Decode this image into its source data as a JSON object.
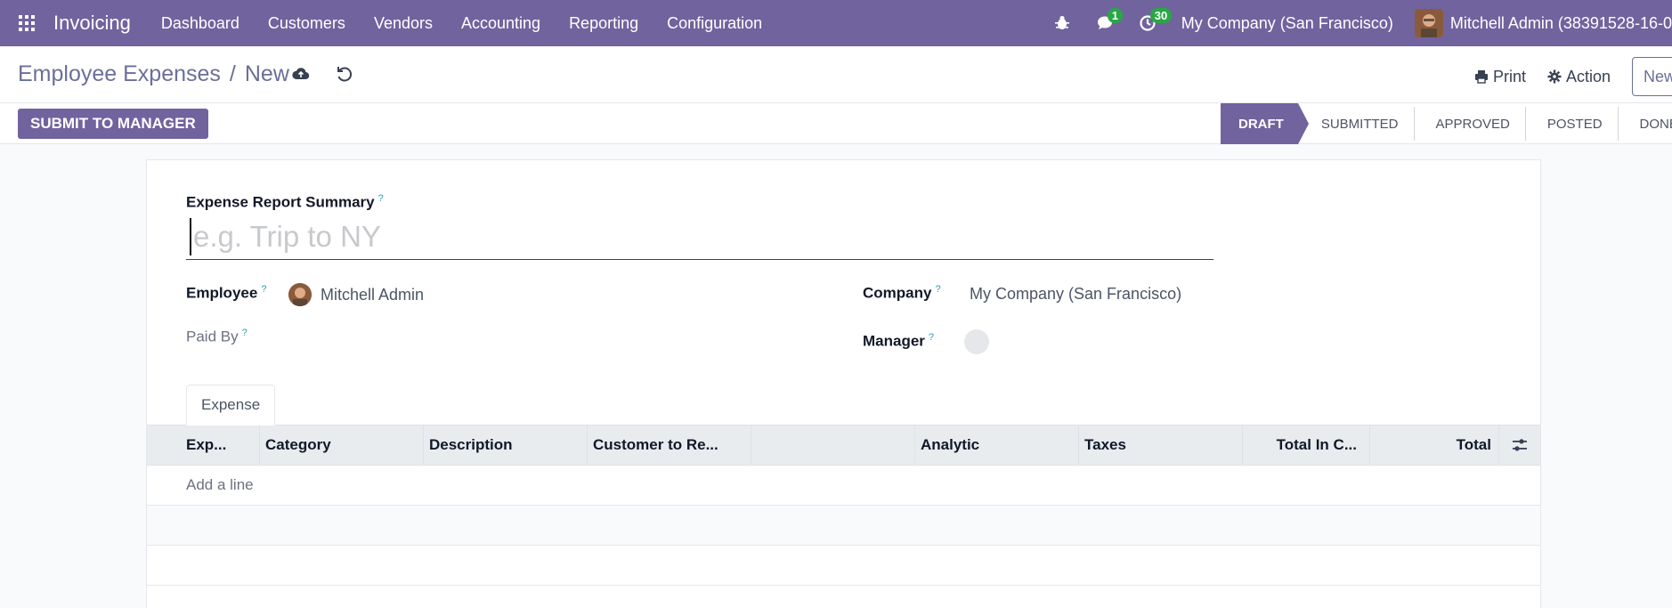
{
  "navbar": {
    "app_name": "Invoicing",
    "menu": [
      "Dashboard",
      "Customers",
      "Vendors",
      "Accounting",
      "Reporting",
      "Configuration"
    ],
    "messages_count": "1",
    "activities_count": "30",
    "company": "My Company (San Francisco)",
    "user": "Mitchell Admin (38391528-16-0"
  },
  "control_panel": {
    "breadcrumb_parent": "Employee Expenses",
    "separator": "/",
    "breadcrumb_current": "New",
    "print_label": "Print",
    "action_label": "Action",
    "new_label": "New"
  },
  "statusbar": {
    "submit_label": "SUBMIT TO MANAGER",
    "stages": [
      "DRAFT",
      "SUBMITTED",
      "APPROVED",
      "POSTED",
      "DONE"
    ],
    "active_stage": "DRAFT"
  },
  "form": {
    "summary_label": "Expense Report Summary",
    "summary_placeholder": "e.g. Trip to NY",
    "help_mark": "?",
    "employee_label": "Employee",
    "employee_value": "Mitchell Admin",
    "paid_by_label": "Paid By",
    "company_label": "Company",
    "company_value": "My Company (San Francisco)",
    "manager_label": "Manager"
  },
  "tabs": [
    "Expense"
  ],
  "table": {
    "columns": [
      "Exp...",
      "Category",
      "Description",
      "Customer to Re...",
      "",
      "Analytic",
      "Taxes",
      "Total In C...",
      "Total"
    ],
    "add_line": "Add a line"
  },
  "colors": {
    "brand": "#71639e",
    "badge": "#28a745"
  }
}
